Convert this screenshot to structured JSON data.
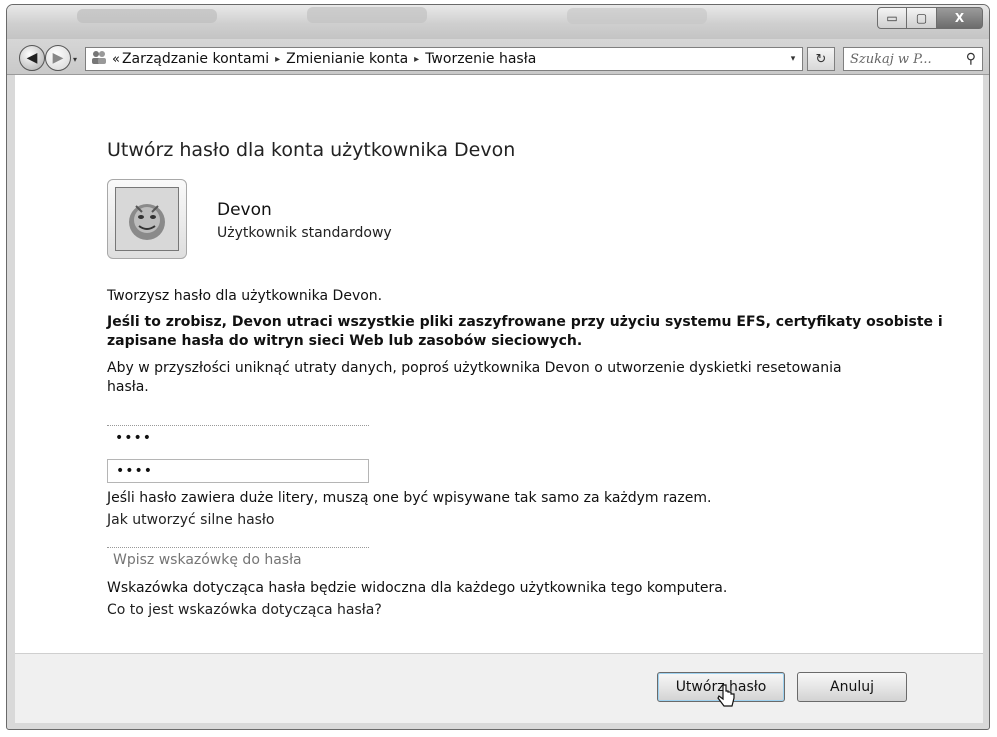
{
  "window": {
    "controls": {
      "minimize": "▭",
      "maximize": "▢",
      "close": "X"
    }
  },
  "navigation": {
    "back": "◀",
    "forward": "▶",
    "history": "▾"
  },
  "address": {
    "lead": "«",
    "breadcrumb": [
      "Zarządzanie kontami",
      "Zmienianie konta",
      "Tworzenie hasła"
    ],
    "separator": "▸",
    "dropdown": "▾",
    "refresh": "↻"
  },
  "search": {
    "placeholder": "Szukaj w P...",
    "icon": "⚲"
  },
  "page": {
    "title": "Utwórz hasło dla konta użytkownika Devon"
  },
  "user": {
    "name": "Devon",
    "type": "Użytkownik standardowy",
    "avatar_icon": "user-avatar-icon"
  },
  "messages": {
    "intro": "Tworzysz hasło dla użytkownika Devon.",
    "warning_line1": "Jeśli to zrobisz, Devon utraci wszystkie pliki zaszyfrowane przy użyciu systemu EFS, certyfikaty osobiste i",
    "warning_line2": "zapisane hasła do witryn sieci Web lub zasobów sieciowych.",
    "advice_line1": "Aby w przyszłości uniknąć utraty danych, poproś użytkownika Devon o utworzenie dyskietki resetowania",
    "advice_line2": "hasła."
  },
  "form": {
    "new_password": "••••",
    "confirm_password": "••••",
    "case_note": "Jeśli hasło zawiera duże litery, muszą one być wpisywane tak samo za każdym razem.",
    "strong_password_link": "Jak utworzyć silne hasło",
    "hint_placeholder": "Wpisz wskazówkę do hasła",
    "hint_note": "Wskazówka dotycząca hasła będzie widoczna dla każdego użytkownika tego komputera.",
    "hint_help_link": "Co to jest wskazówka dotycząca hasła?"
  },
  "buttons": {
    "create": "Utwórz hasło",
    "cancel": "Anuluj"
  }
}
